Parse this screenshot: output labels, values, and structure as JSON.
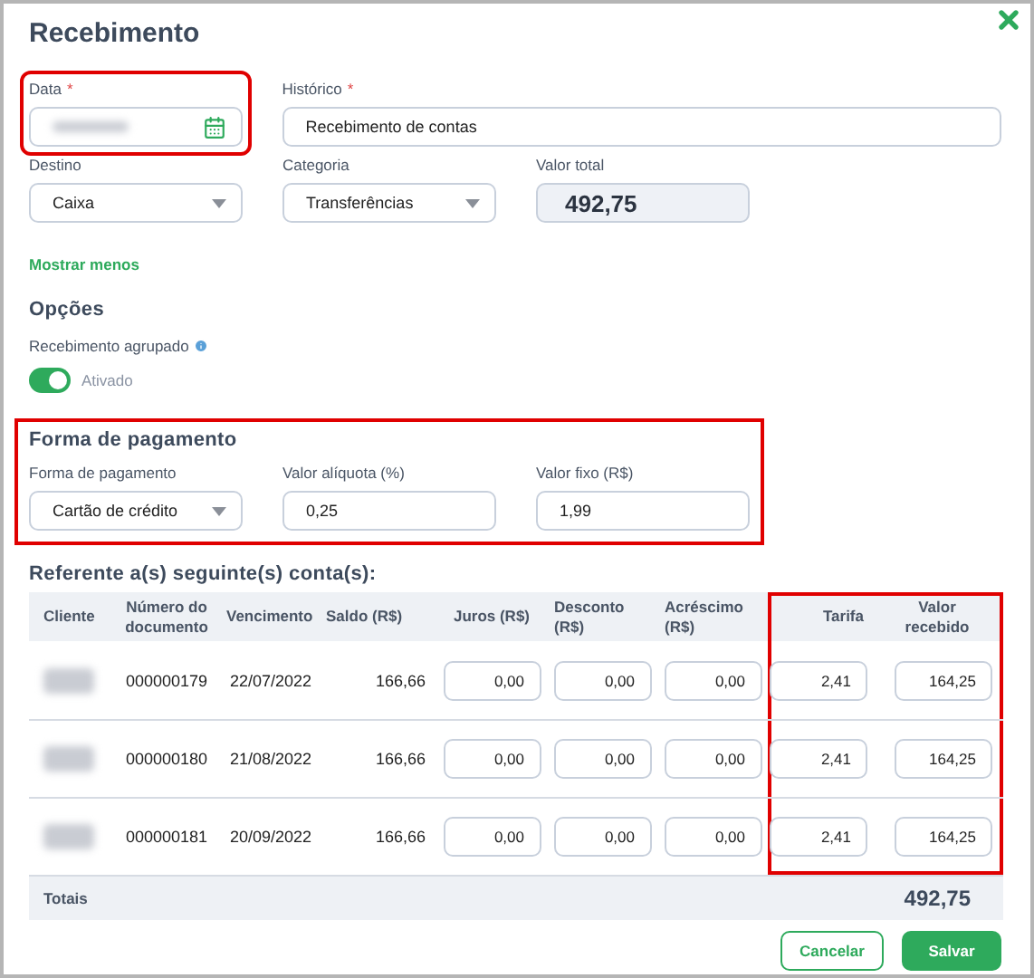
{
  "window": {
    "title": "Recebimento"
  },
  "date_field": {
    "label": "Data",
    "required_mark": "*",
    "redacted": true,
    "highlighted": true
  },
  "history_field": {
    "label": "Histórico",
    "required_mark": "*",
    "value": "Recebimento de contas"
  },
  "destination": {
    "label": "Destino",
    "value": "Caixa"
  },
  "category": {
    "label": "Categoria",
    "value": "Transferências"
  },
  "total_value": {
    "label": "Valor total",
    "value": "492,75"
  },
  "toggle_link": "Mostrar menos",
  "options": {
    "title": "Opções",
    "grouped_label": "Recebimento agrupado",
    "grouped_on": true,
    "grouped_state": "Ativado"
  },
  "payment": {
    "title": "Forma de pagamento",
    "highlighted": true,
    "method_label": "Forma de pagamento",
    "method": "Cartão de crédito",
    "rate_label": "Valor alíquota (%)",
    "rate": "0,25",
    "fixed_label": "Valor fixo (R$)",
    "fixed": "1,99"
  },
  "accounts": {
    "title": "Referente a(s) seguinte(s) conta(s):",
    "columns": [
      {
        "label": "Cliente",
        "highlighted": false
      },
      {
        "label": "Número do documento",
        "highlighted": false
      },
      {
        "label": "Vencimento",
        "highlighted": false
      },
      {
        "label": "Saldo (R$)",
        "highlighted": false
      },
      {
        "label": "Juros (R$)",
        "highlighted": false
      },
      {
        "label": "Desconto (R$)",
        "highlighted": false
      },
      {
        "label": "Acréscimo (R$)",
        "highlighted": false
      },
      {
        "label": "Tarifa",
        "highlighted": true
      },
      {
        "label": "Valor recebido",
        "highlighted": true
      }
    ],
    "rows": [
      {
        "client_redacted": true,
        "document": "000000179",
        "due": "22/07/2022",
        "balance": "166,66",
        "interest": "0,00",
        "discount": "0,00",
        "addition": "0,00",
        "fee": "2,41",
        "received": "164,25"
      },
      {
        "client_redacted": true,
        "document": "000000180",
        "due": "21/08/2022",
        "balance": "166,66",
        "interest": "0,00",
        "discount": "0,00",
        "addition": "0,00",
        "fee": "2,41",
        "received": "164,25"
      },
      {
        "client_redacted": true,
        "document": "000000181",
        "due": "20/09/2022",
        "balance": "166,66",
        "interest": "0,00",
        "discount": "0,00",
        "addition": "0,00",
        "fee": "2,41",
        "received": "164,25"
      }
    ],
    "totals_label": "Totais",
    "totals_value": "492,75"
  },
  "buttons": [
    {
      "label": "Cancelar",
      "kind": "secondary"
    },
    {
      "label": "Salvar",
      "kind": "primary"
    }
  ]
}
